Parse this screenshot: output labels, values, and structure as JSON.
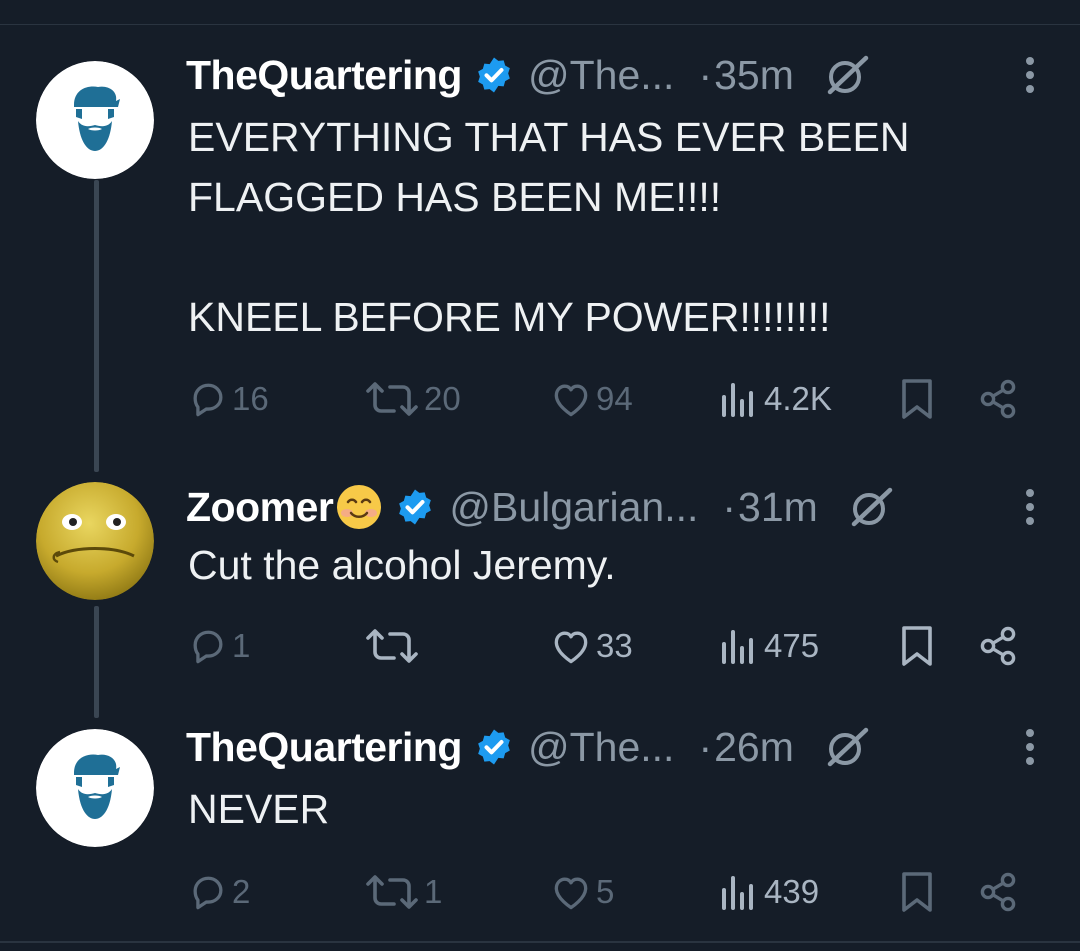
{
  "tweets": [
    {
      "author": "TheQuartering",
      "handle": "@The...",
      "time_sep": "·",
      "time": "35m",
      "body": [
        "EVERYTHING THAT HAS EVER BEEN FLAGGED HAS BEEN ME!!!!",
        "",
        "KNEEL BEFORE MY POWER!!!!!!!!"
      ],
      "replies": "16",
      "reposts": "20",
      "likes": "94",
      "views": "4.2K",
      "avatar_icon": "bearded-man-avatar-icon"
    },
    {
      "author": "Zoomer",
      "author_emoji": "smiling-face-emoji",
      "handle": "@Bulgarian...",
      "time_sep": "·",
      "time": "31m",
      "body": [
        "Cut the alcohol Jeremy."
      ],
      "replies": "1",
      "reposts": "",
      "likes": "33",
      "views": "475",
      "avatar_icon": "smug-smiley-avatar-icon"
    },
    {
      "author": "TheQuartering",
      "handle": "@The...",
      "time_sep": "·",
      "time": "26m",
      "body": [
        "NEVER"
      ],
      "replies": "2",
      "reposts": "1",
      "likes": "5",
      "views": "439",
      "avatar_icon": "bearded-man-avatar-icon"
    }
  ],
  "colors": {
    "background": "#151d28",
    "verified_badge": "#1d9bf0",
    "secondary_text": "#8b98a5",
    "thread_line": "#3a4653"
  }
}
